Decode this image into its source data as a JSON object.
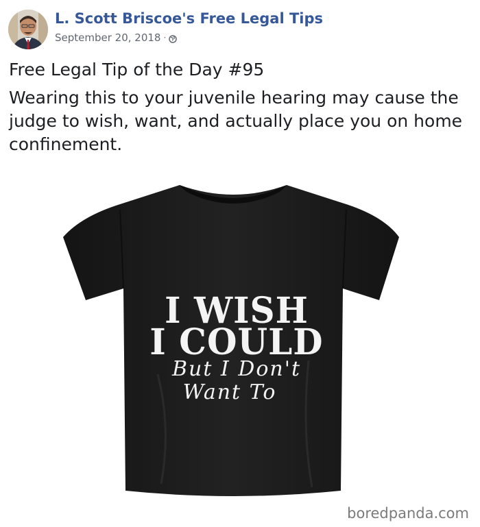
{
  "post": {
    "author": "L. Scott Briscoe's Free Legal Tips",
    "date": "September 20, 2018",
    "separator": "·",
    "privacy_icon": "globe-icon",
    "title": "Free Legal Tip of the Day #95",
    "body": "Wearing this to your juvenile hearing may cause the judge to wish, want, and actually place you on home confinement."
  },
  "photo": {
    "shirt_lines": [
      "I WISH",
      "I COULD",
      "But I Don't",
      "Want To"
    ],
    "shirt_color": "#1b1b1b",
    "watermark": "boredpanda.com"
  },
  "colors": {
    "author_link": "#365899",
    "meta": "#606770",
    "text": "#1c1e21"
  }
}
